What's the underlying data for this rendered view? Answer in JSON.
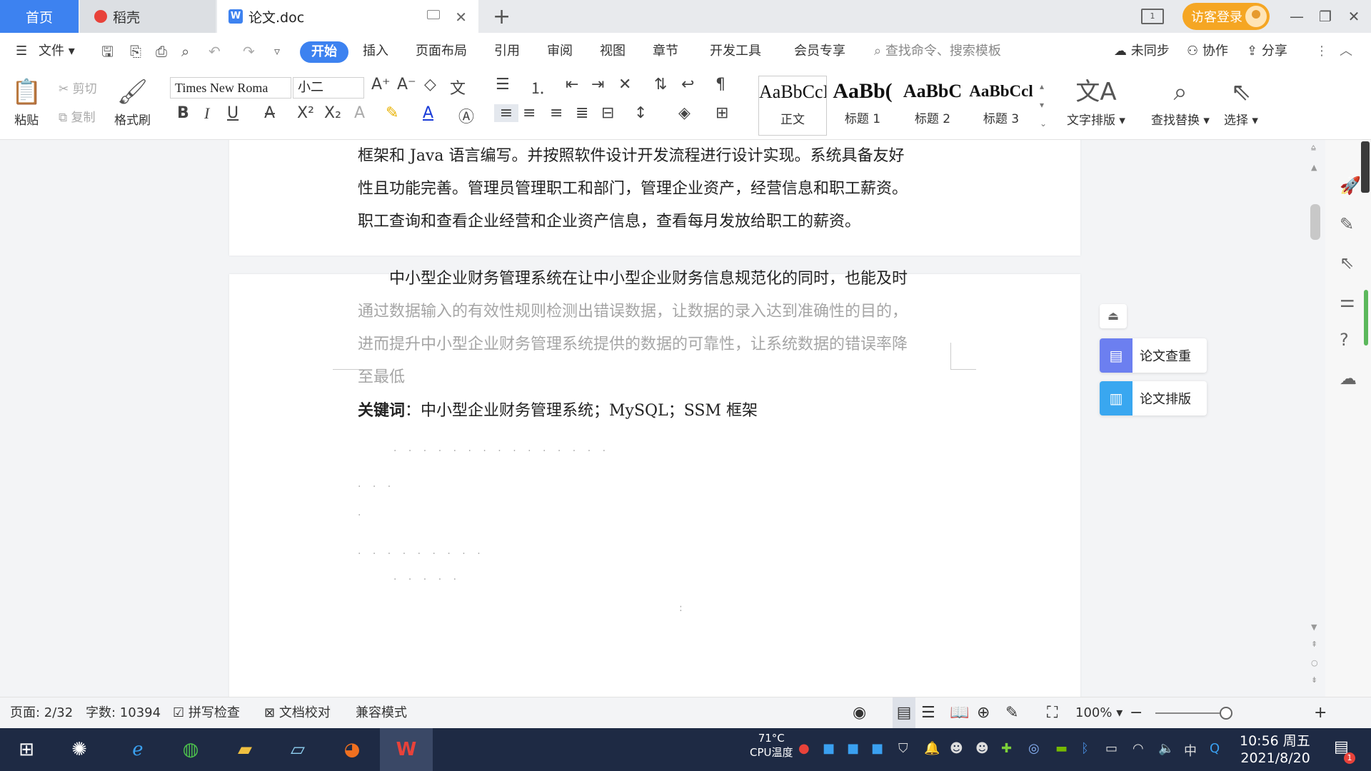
{
  "tabs": {
    "home": "首页",
    "daoke": "稻壳",
    "doc": "论文.doc"
  },
  "window": {
    "layout_num": "1",
    "visitor_login": "访客登录"
  },
  "menu": {
    "file": "文件",
    "items": [
      "开始",
      "插入",
      "页面布局",
      "引用",
      "审阅",
      "视图",
      "章节",
      "开发工具",
      "会员专享"
    ],
    "search_placeholder": "查找命令、搜索模板",
    "unsynced": "未同步",
    "collab": "协作",
    "share": "分享"
  },
  "ribbon": {
    "paste": "粘贴",
    "cut": "剪切",
    "copy": "复制",
    "format_painter": "格式刷",
    "font_name": "Times New Roma",
    "font_size": "小二",
    "styles": [
      {
        "sample": "AaBbCcI",
        "label": "正文"
      },
      {
        "sample": "AaBb(",
        "label": "标题 1"
      },
      {
        "sample": "AaBbC",
        "label": "标题 2"
      },
      {
        "sample": "AaBbCcl",
        "label": "标题 3"
      }
    ],
    "text_layout": "文字排版",
    "find_replace": "查找替换",
    "select": "选择"
  },
  "document": {
    "page1_lines": [
      "框架和 Java 语言编写。并按照软件设计开发流程进行设计实现。系统具备友好",
      "性且功能完善。管理员管理职工和部门，管理企业资产，经营信息和职工薪资。",
      "职工查询和查看企业经营和企业资产信息，查看每月发放给职工的薪资。"
    ],
    "page2_lines": [
      "中小型企业财务管理系统在让中小型企业财务信息规范化的同时，也能及时",
      "通过数据输入的有效性规则检测出错误数据，让数据的录入达到准确性的目的，",
      "进而提升中小型企业财务管理系统提供的数据的可靠性，让系统数据的错误率降",
      "至最低"
    ],
    "keywords_label": "关键词",
    "keywords_sep": "：",
    "keywords_text": "中小型企业财务管理系统；MySQL；SSM 框架"
  },
  "side_panel": {
    "check": "论文查重",
    "layout": "论文排版"
  },
  "status": {
    "page": "页面: 2/32",
    "words": "字数: 10394",
    "spell": "拼写检查",
    "proof": "文档校对",
    "compat": "兼容模式",
    "zoom": "100%"
  },
  "taskbar": {
    "temp": "71°C",
    "cpu": "CPU温度",
    "ime": "中",
    "time": "10:56 周五",
    "date": "2021/8/20",
    "notif_count": "1"
  },
  "colors": {
    "accent": "#3d82f0",
    "login": "#f5a623",
    "taskbar": "#1e2a44"
  }
}
